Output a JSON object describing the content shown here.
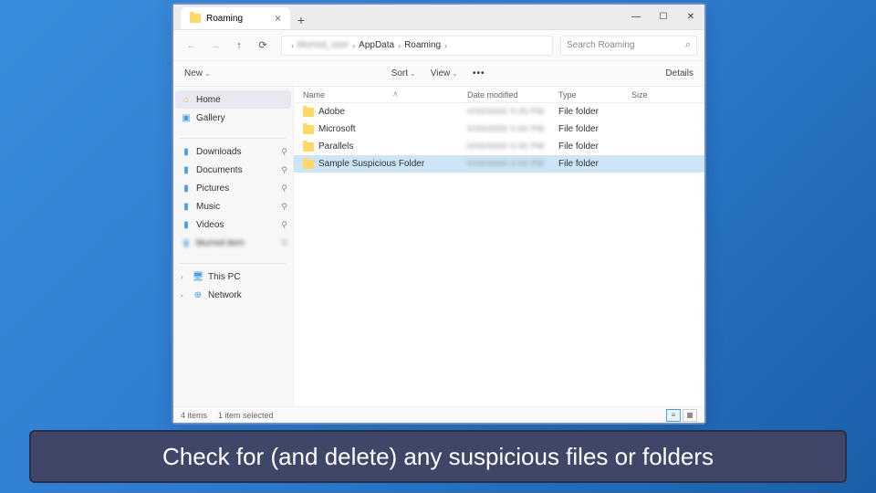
{
  "window": {
    "tab_title": "Roaming",
    "controls": {
      "min": "—",
      "max": "☐",
      "close": "✕"
    }
  },
  "addressbar": {
    "breadcrumb": [
      "blurred_user",
      "AppData",
      "Roaming"
    ],
    "blurred_text": "blurred_user"
  },
  "search": {
    "placeholder": "Search Roaming"
  },
  "toolbar": {
    "new_label": "New",
    "sort_label": "Sort",
    "view_label": "View",
    "details_label": "Details"
  },
  "sidebar": {
    "main": [
      {
        "icon": "home",
        "label": "Home",
        "selected": true
      },
      {
        "icon": "gallery",
        "label": "Gallery"
      }
    ],
    "quick": [
      {
        "icon": "folder",
        "label": "Downloads",
        "pinned": true
      },
      {
        "icon": "folder",
        "label": "Documents",
        "pinned": true
      },
      {
        "icon": "folder",
        "label": "Pictures",
        "pinned": true
      },
      {
        "icon": "folder",
        "label": "Music",
        "pinned": true
      },
      {
        "icon": "folder",
        "label": "Videos",
        "pinned": true
      },
      {
        "icon": "folder",
        "label": "blurred item",
        "pinned": true,
        "blur": true
      }
    ],
    "drives": [
      {
        "icon": "pc",
        "label": "This PC",
        "expandable": true
      },
      {
        "icon": "net",
        "label": "Network",
        "expandable": true
      }
    ]
  },
  "columns": {
    "name": "Name",
    "date": "Date modified",
    "type": "Type",
    "size": "Size"
  },
  "files": [
    {
      "name": "Adobe",
      "date": "0/00/0000 0:00 PM",
      "type": "File folder",
      "selected": false
    },
    {
      "name": "Microsoft",
      "date": "0/00/0000 0:00 PM",
      "type": "File folder",
      "selected": false
    },
    {
      "name": "Parallels",
      "date": "0/00/0000 0:00 PM",
      "type": "File folder",
      "selected": false
    },
    {
      "name": "Sample Suspicious Folder",
      "date": "0/00/0000 0:00 PM",
      "type": "File folder",
      "selected": true
    }
  ],
  "status": {
    "count": "4 items",
    "selected": "1 item selected"
  },
  "caption": "Check for (and delete) any suspicious files or folders"
}
